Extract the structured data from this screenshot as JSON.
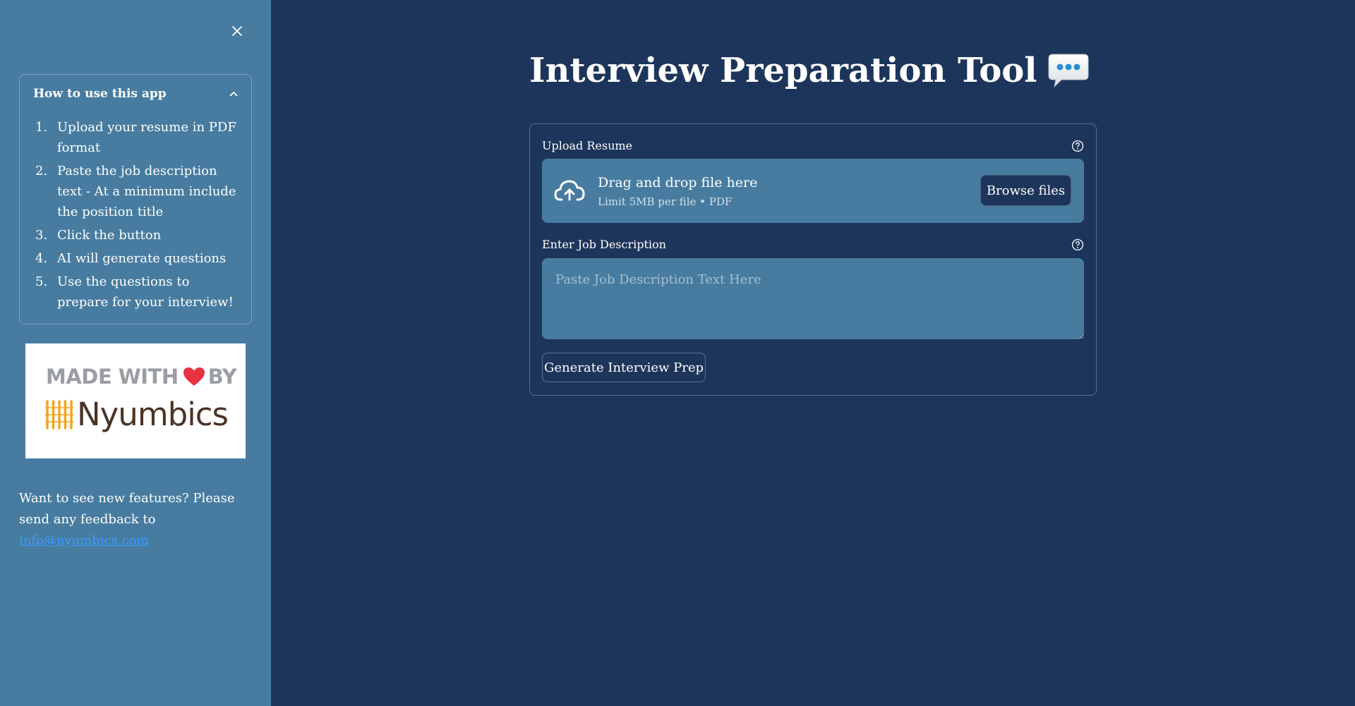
{
  "sidebar": {
    "close_icon": "close-icon",
    "how_to": {
      "title": "How to use this app",
      "steps": [
        {
          "num": "1.",
          "text": "Upload your resume in PDF format"
        },
        {
          "num": "2.",
          "text": "Paste the job description text - At a minimum include the position title"
        },
        {
          "num": "3.",
          "text": "Click the button"
        },
        {
          "num": "4.",
          "text": "AI will generate questions"
        },
        {
          "num": "5.",
          "text": "Use the questions to prepare for your interview!"
        }
      ]
    },
    "logo": {
      "made_with": "MADE WITH",
      "by": "BY",
      "brand": "Nyumbics",
      "heart_color": "#e8323f",
      "brand_accent": "#f2a51f"
    },
    "feedback": {
      "text": "Want to see new features? Please send any feedback to ",
      "email": "info@nyumbics.com"
    }
  },
  "main": {
    "title": "Interview Preparation Tool",
    "title_icon": "speech-bubble-icon",
    "upload": {
      "label": "Upload Resume",
      "drag_text": "Drag and drop file here",
      "limit_text": "Limit 5MB per file • PDF",
      "browse_label": "Browse files"
    },
    "job_description": {
      "label": "Enter Job Description",
      "placeholder": "Paste Job Description Text Here",
      "value": ""
    },
    "generate_label": "Generate Interview Prep"
  },
  "colors": {
    "main_bg": "#1d355a",
    "sidebar_bg": "#477ca0",
    "link": "#3b9bff"
  }
}
